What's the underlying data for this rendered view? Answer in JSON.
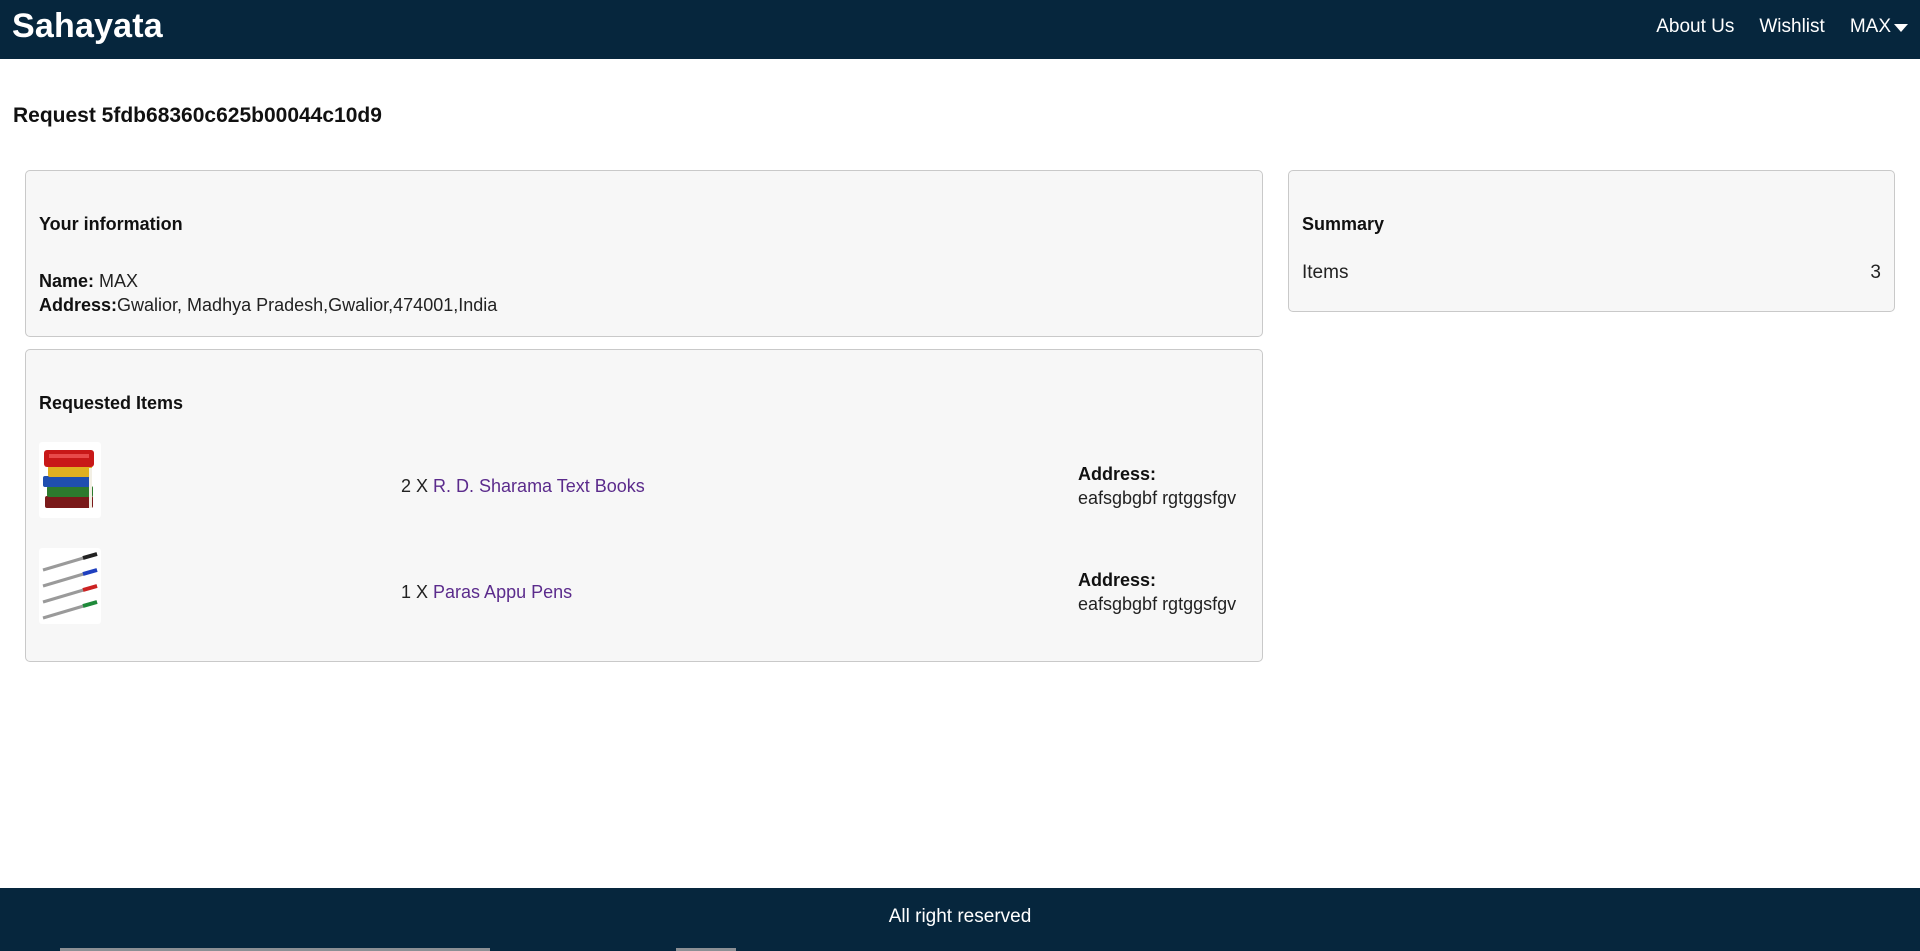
{
  "theme": {
    "nav_bg": "#06263d",
    "link_color": "#5b2b8c"
  },
  "navbar": {
    "brand": "Sahayata",
    "links": [
      {
        "label": "About Us"
      },
      {
        "label": "Wishlist"
      }
    ],
    "user_label": "MAX"
  },
  "page": {
    "title": "Request 5fdb68360c625b00044c10d9"
  },
  "info": {
    "heading": "Your information",
    "name_label": "Name:",
    "name_value": " MAX",
    "address_label": "Address:",
    "address_value": "Gwalior, Madhya Pradesh,Gwalior,474001,India"
  },
  "requested": {
    "heading": "Requested Items",
    "items": [
      {
        "qty": "2 X ",
        "name": "R. D. Sharama Text Books",
        "address_label": "Address:",
        "address": "eafsgbgbf rgtggsfgv",
        "icon": "books-icon"
      },
      {
        "qty": "1 X ",
        "name": "Paras Appu Pens",
        "address_label": "Address:",
        "address": "eafsgbgbf rgtggsfgv",
        "icon": "pens-icon"
      }
    ]
  },
  "summary": {
    "heading": "Summary",
    "items_label": "Items",
    "items_count": "3"
  },
  "footer": {
    "text": "All right reserved"
  }
}
